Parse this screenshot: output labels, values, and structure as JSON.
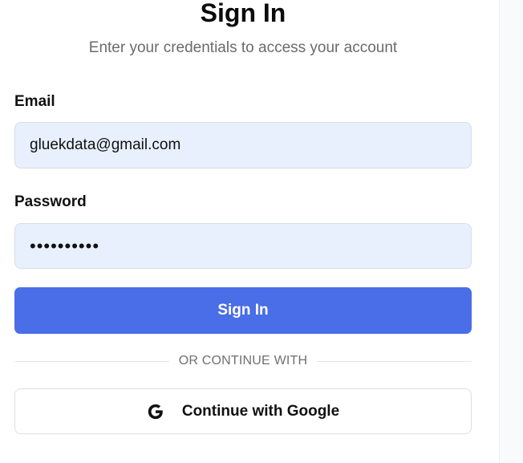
{
  "header": {
    "title": "Sign In",
    "subtitle": "Enter your credentials to access your account"
  },
  "form": {
    "email_label": "Email",
    "email_value": "gluekdata@gmail.com",
    "password_label": "Password",
    "password_value": "••••••••••",
    "submit_label": "Sign In"
  },
  "divider": {
    "text": "OR CONTINUE WITH"
  },
  "social": {
    "google_label": "Continue with Google",
    "google_icon": "google-g-icon"
  },
  "colors": {
    "primary": "#4a6de8",
    "input_background": "#e8f0fd"
  }
}
